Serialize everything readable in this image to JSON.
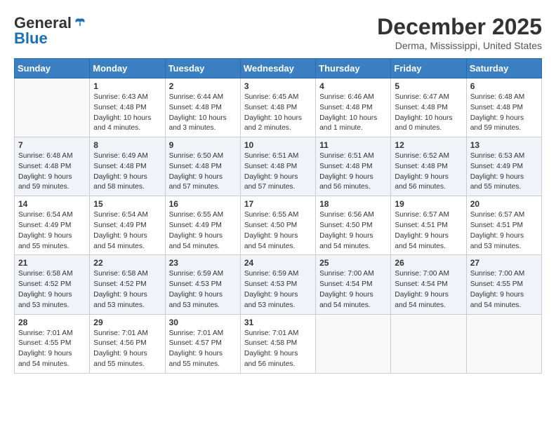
{
  "header": {
    "logo_general": "General",
    "logo_blue": "Blue",
    "month_title": "December 2025",
    "location": "Derma, Mississippi, United States"
  },
  "weekdays": [
    "Sunday",
    "Monday",
    "Tuesday",
    "Wednesday",
    "Thursday",
    "Friday",
    "Saturday"
  ],
  "weeks": [
    [
      {
        "day": "",
        "info": ""
      },
      {
        "day": "1",
        "info": "Sunrise: 6:43 AM\nSunset: 4:48 PM\nDaylight: 10 hours\nand 4 minutes."
      },
      {
        "day": "2",
        "info": "Sunrise: 6:44 AM\nSunset: 4:48 PM\nDaylight: 10 hours\nand 3 minutes."
      },
      {
        "day": "3",
        "info": "Sunrise: 6:45 AM\nSunset: 4:48 PM\nDaylight: 10 hours\nand 2 minutes."
      },
      {
        "day": "4",
        "info": "Sunrise: 6:46 AM\nSunset: 4:48 PM\nDaylight: 10 hours\nand 1 minute."
      },
      {
        "day": "5",
        "info": "Sunrise: 6:47 AM\nSunset: 4:48 PM\nDaylight: 10 hours\nand 0 minutes."
      },
      {
        "day": "6",
        "info": "Sunrise: 6:48 AM\nSunset: 4:48 PM\nDaylight: 9 hours\nand 59 minutes."
      }
    ],
    [
      {
        "day": "7",
        "info": "Sunrise: 6:48 AM\nSunset: 4:48 PM\nDaylight: 9 hours\nand 59 minutes."
      },
      {
        "day": "8",
        "info": "Sunrise: 6:49 AM\nSunset: 4:48 PM\nDaylight: 9 hours\nand 58 minutes."
      },
      {
        "day": "9",
        "info": "Sunrise: 6:50 AM\nSunset: 4:48 PM\nDaylight: 9 hours\nand 57 minutes."
      },
      {
        "day": "10",
        "info": "Sunrise: 6:51 AM\nSunset: 4:48 PM\nDaylight: 9 hours\nand 57 minutes."
      },
      {
        "day": "11",
        "info": "Sunrise: 6:51 AM\nSunset: 4:48 PM\nDaylight: 9 hours\nand 56 minutes."
      },
      {
        "day": "12",
        "info": "Sunrise: 6:52 AM\nSunset: 4:48 PM\nDaylight: 9 hours\nand 56 minutes."
      },
      {
        "day": "13",
        "info": "Sunrise: 6:53 AM\nSunset: 4:49 PM\nDaylight: 9 hours\nand 55 minutes."
      }
    ],
    [
      {
        "day": "14",
        "info": "Sunrise: 6:54 AM\nSunset: 4:49 PM\nDaylight: 9 hours\nand 55 minutes."
      },
      {
        "day": "15",
        "info": "Sunrise: 6:54 AM\nSunset: 4:49 PM\nDaylight: 9 hours\nand 54 minutes."
      },
      {
        "day": "16",
        "info": "Sunrise: 6:55 AM\nSunset: 4:49 PM\nDaylight: 9 hours\nand 54 minutes."
      },
      {
        "day": "17",
        "info": "Sunrise: 6:55 AM\nSunset: 4:50 PM\nDaylight: 9 hours\nand 54 minutes."
      },
      {
        "day": "18",
        "info": "Sunrise: 6:56 AM\nSunset: 4:50 PM\nDaylight: 9 hours\nand 54 minutes."
      },
      {
        "day": "19",
        "info": "Sunrise: 6:57 AM\nSunset: 4:51 PM\nDaylight: 9 hours\nand 54 minutes."
      },
      {
        "day": "20",
        "info": "Sunrise: 6:57 AM\nSunset: 4:51 PM\nDaylight: 9 hours\nand 53 minutes."
      }
    ],
    [
      {
        "day": "21",
        "info": "Sunrise: 6:58 AM\nSunset: 4:52 PM\nDaylight: 9 hours\nand 53 minutes."
      },
      {
        "day": "22",
        "info": "Sunrise: 6:58 AM\nSunset: 4:52 PM\nDaylight: 9 hours\nand 53 minutes."
      },
      {
        "day": "23",
        "info": "Sunrise: 6:59 AM\nSunset: 4:53 PM\nDaylight: 9 hours\nand 53 minutes."
      },
      {
        "day": "24",
        "info": "Sunrise: 6:59 AM\nSunset: 4:53 PM\nDaylight: 9 hours\nand 53 minutes."
      },
      {
        "day": "25",
        "info": "Sunrise: 7:00 AM\nSunset: 4:54 PM\nDaylight: 9 hours\nand 54 minutes."
      },
      {
        "day": "26",
        "info": "Sunrise: 7:00 AM\nSunset: 4:54 PM\nDaylight: 9 hours\nand 54 minutes."
      },
      {
        "day": "27",
        "info": "Sunrise: 7:00 AM\nSunset: 4:55 PM\nDaylight: 9 hours\nand 54 minutes."
      }
    ],
    [
      {
        "day": "28",
        "info": "Sunrise: 7:01 AM\nSunset: 4:55 PM\nDaylight: 9 hours\nand 54 minutes."
      },
      {
        "day": "29",
        "info": "Sunrise: 7:01 AM\nSunset: 4:56 PM\nDaylight: 9 hours\nand 55 minutes."
      },
      {
        "day": "30",
        "info": "Sunrise: 7:01 AM\nSunset: 4:57 PM\nDaylight: 9 hours\nand 55 minutes."
      },
      {
        "day": "31",
        "info": "Sunrise: 7:01 AM\nSunset: 4:58 PM\nDaylight: 9 hours\nand 56 minutes."
      },
      {
        "day": "",
        "info": ""
      },
      {
        "day": "",
        "info": ""
      },
      {
        "day": "",
        "info": ""
      }
    ]
  ]
}
